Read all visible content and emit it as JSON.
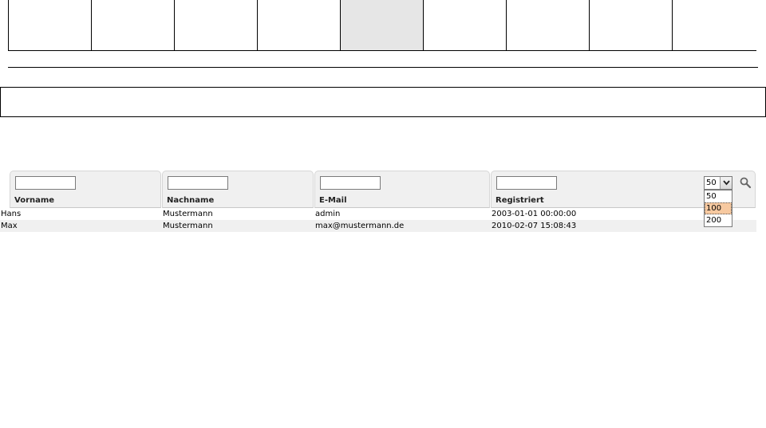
{
  "menu": {
    "cell_count": 9,
    "active_index": 4
  },
  "grid": {
    "columns": [
      {
        "label": "Vorname",
        "filter_value": ""
      },
      {
        "label": "Nachname",
        "filter_value": ""
      },
      {
        "label": "E-Mail",
        "filter_value": ""
      },
      {
        "label": "Registriert",
        "filter_value": ""
      }
    ],
    "page_size": {
      "selected": "50",
      "options": [
        "50",
        "100",
        "200"
      ],
      "highlighted": "100"
    },
    "search_icon": "magnifier-icon",
    "rows": [
      {
        "vorname": "Hans",
        "nachname": "Mustermann",
        "email": "admin",
        "registriert": "2003-01-01 00:00:00"
      },
      {
        "vorname": "Max",
        "nachname": "Mustermann",
        "email": "max@mustermann.de",
        "registriert": "2010-02-07 15:08:43"
      }
    ]
  },
  "colors": {
    "header_bg": "#f0f0f0",
    "active_menu_bg": "#e6e6e6",
    "highlight_option_bg": "#f7c9a0",
    "even_row_bg": "#f0f0f0"
  }
}
